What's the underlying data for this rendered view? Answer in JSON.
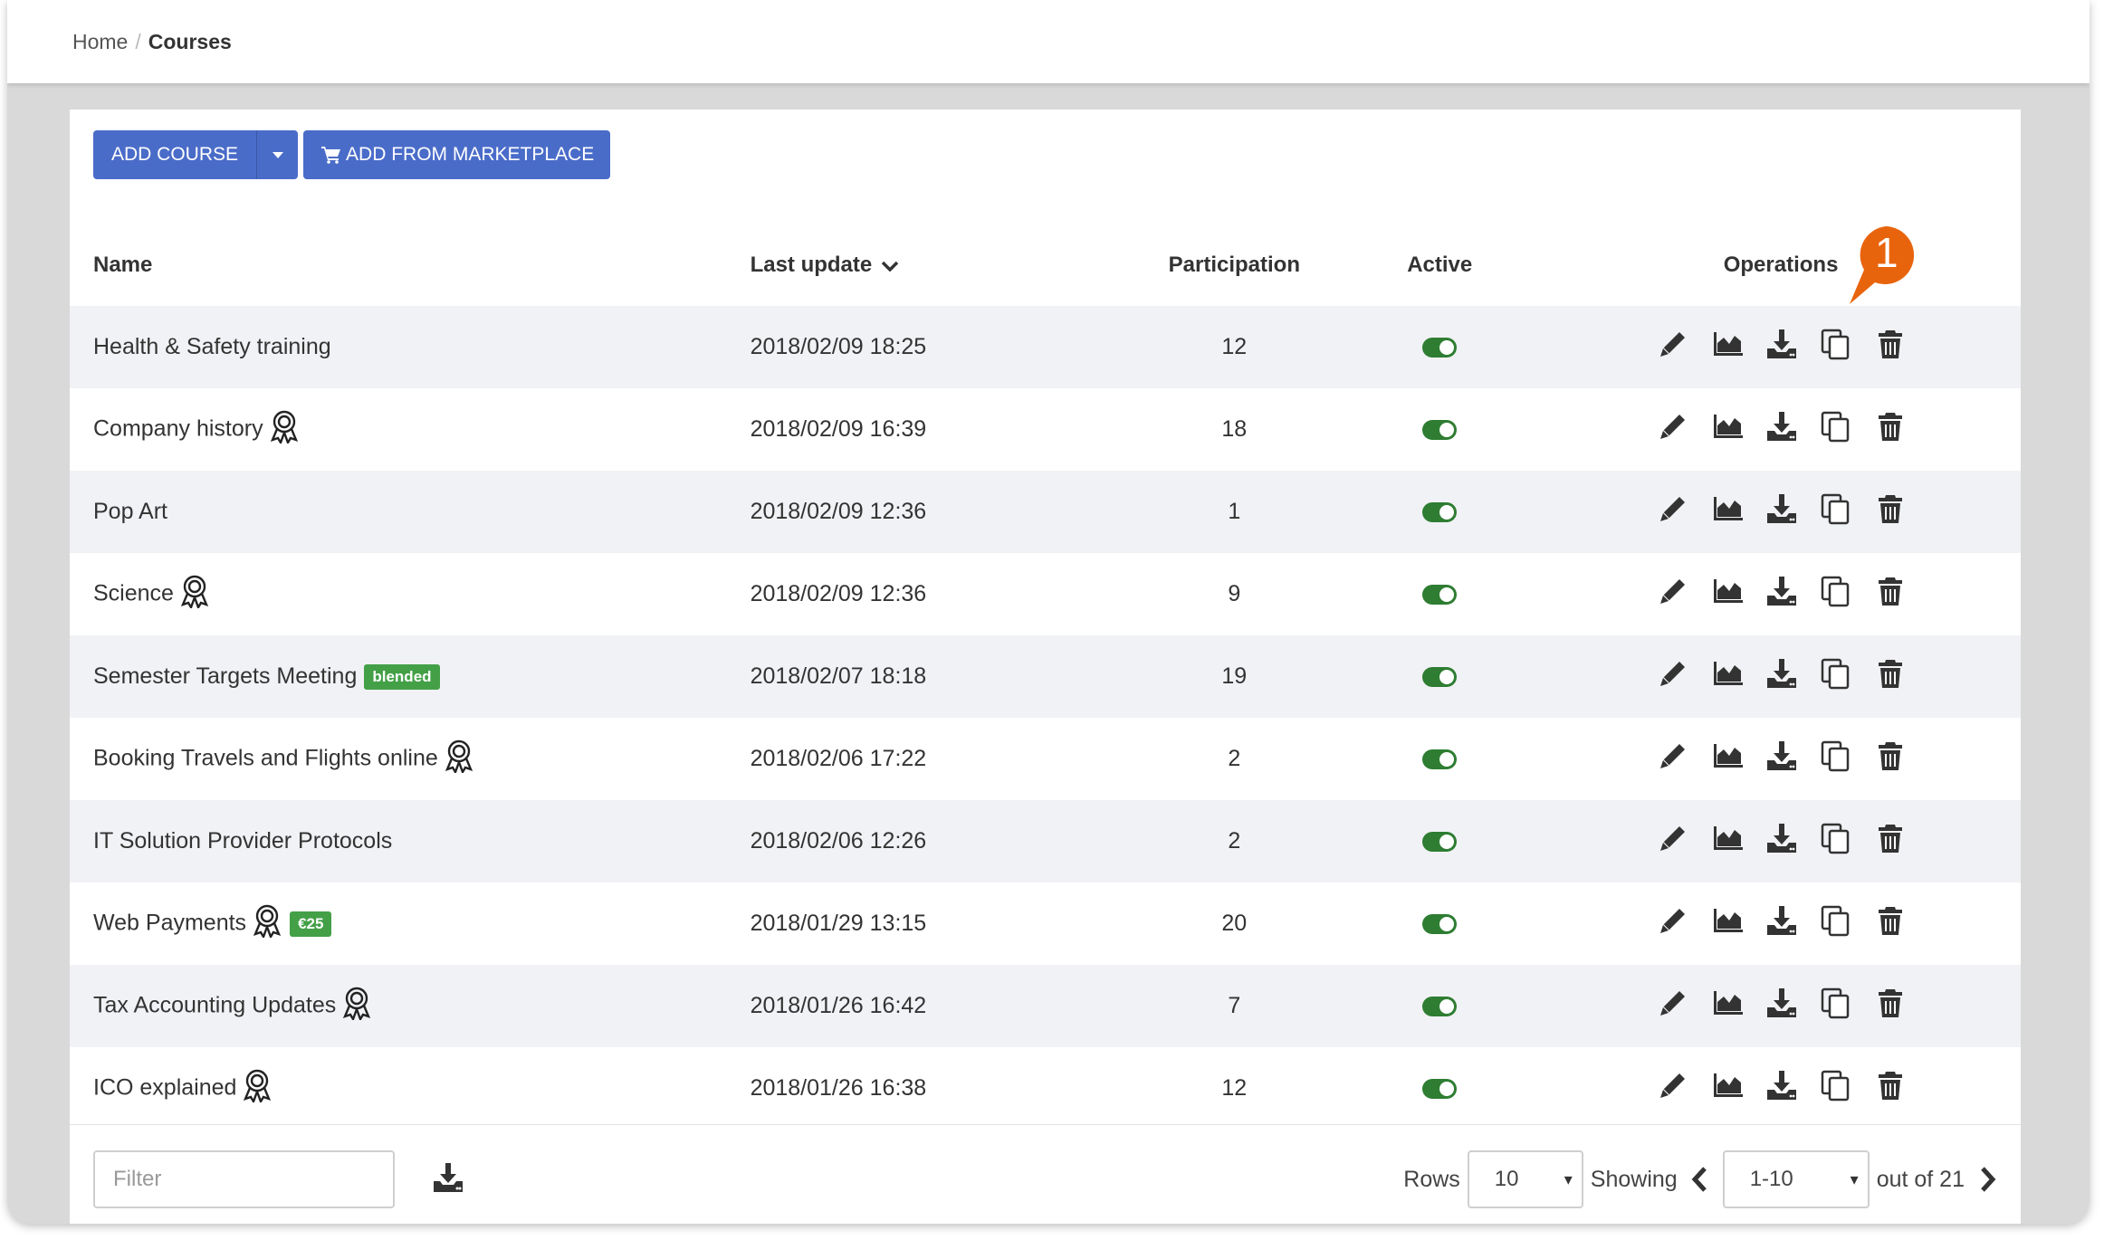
{
  "breadcrumb": {
    "home": "Home",
    "separator": "/",
    "current": "Courses"
  },
  "toolbar": {
    "add_course_label": "ADD COURSE",
    "add_from_marketplace_label": "ADD FROM MARKETPLACE",
    "cart_icon": "shopping-cart-icon",
    "caret_icon": "caret-down-icon"
  },
  "table": {
    "headers": {
      "name": "Name",
      "last_update": "Last update",
      "participation": "Participation",
      "active": "Active",
      "operations": "Operations"
    },
    "rows": [
      {
        "name": "Health & Safety training",
        "certificate": false,
        "tag": "",
        "last_update": "2018/02/09 18:25",
        "participation": "12",
        "active": true
      },
      {
        "name": "Company history",
        "certificate": true,
        "tag": "",
        "last_update": "2018/02/09 16:39",
        "participation": "18",
        "active": true
      },
      {
        "name": "Pop Art",
        "certificate": false,
        "tag": "",
        "last_update": "2018/02/09 12:36",
        "participation": "1",
        "active": true
      },
      {
        "name": "Science",
        "certificate": true,
        "tag": "",
        "last_update": "2018/02/09 12:36",
        "participation": "9",
        "active": true
      },
      {
        "name": "Semester Targets Meeting",
        "certificate": false,
        "tag": "blended",
        "last_update": "2018/02/07 18:18",
        "participation": "19",
        "active": true
      },
      {
        "name": "Booking Travels and Flights online",
        "certificate": true,
        "tag": "",
        "last_update": "2018/02/06 17:22",
        "participation": "2",
        "active": true
      },
      {
        "name": "IT Solution Provider Protocols",
        "certificate": false,
        "tag": "",
        "last_update": "2018/02/06 12:26",
        "participation": "2",
        "active": true
      },
      {
        "name": "Web Payments",
        "certificate": true,
        "tag": "€25",
        "last_update": "2018/01/29 13:15",
        "participation": "20",
        "active": true
      },
      {
        "name": "Tax Accounting Updates",
        "certificate": true,
        "tag": "",
        "last_update": "2018/01/26 16:42",
        "participation": "7",
        "active": true
      },
      {
        "name": "ICO explained",
        "certificate": true,
        "tag": "",
        "last_update": "2018/01/26 16:38",
        "participation": "12",
        "active": true
      }
    ],
    "operation_icons": [
      "edit-pencil-icon",
      "reports-chart-icon",
      "download-icon",
      "copy-icon",
      "trash-icon"
    ]
  },
  "footer": {
    "filter_placeholder": "Filter",
    "rows_label": "Rows",
    "rows_value": "10",
    "showing_label": "Showing",
    "range_value": "1-10",
    "out_of_label": "out of 21"
  },
  "annotation": {
    "marker_number": "1",
    "color": "#e8640c"
  },
  "colors": {
    "primary": "#4a6cc9",
    "toggle_on": "#2e7d32",
    "tag_green": "#43a047",
    "stripe": "#f1f2f5"
  }
}
